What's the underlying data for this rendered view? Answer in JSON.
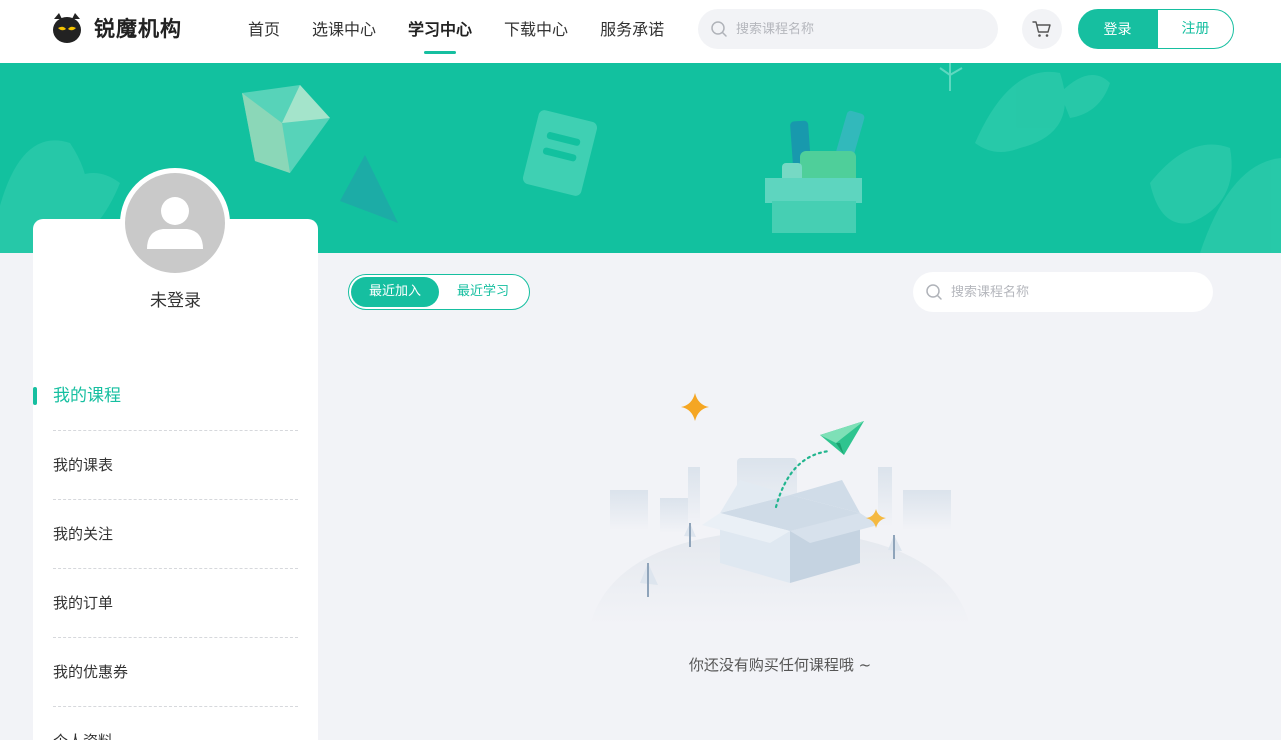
{
  "header": {
    "logo_text": "锐魔机构",
    "nav": [
      {
        "label": "首页",
        "active": false
      },
      {
        "label": "选课中心",
        "active": false
      },
      {
        "label": "学习中心",
        "active": true
      },
      {
        "label": "下载中心",
        "active": false
      },
      {
        "label": "服务承诺",
        "active": false
      }
    ],
    "search_placeholder": "搜索课程名称",
    "login_label": "登录",
    "register_label": "注册"
  },
  "profile": {
    "username": "未登录"
  },
  "sidebar": {
    "items": [
      {
        "label": "我的课程",
        "active": true
      },
      {
        "label": "我的课表",
        "active": false
      },
      {
        "label": "我的关注",
        "active": false
      },
      {
        "label": "我的订单",
        "active": false
      },
      {
        "label": "我的优惠券",
        "active": false
      },
      {
        "label": "个人资料",
        "active": false
      }
    ]
  },
  "main": {
    "tabs": [
      {
        "label": "最近加入",
        "active": true
      },
      {
        "label": "最近学习",
        "active": false
      }
    ],
    "search_placeholder": "搜索课程名称",
    "empty_text": "你还没有购买任何课程哦 ~"
  },
  "colors": {
    "accent": "#16bfa0",
    "banner": "#12c19f",
    "page_bg": "#f2f3f7"
  }
}
